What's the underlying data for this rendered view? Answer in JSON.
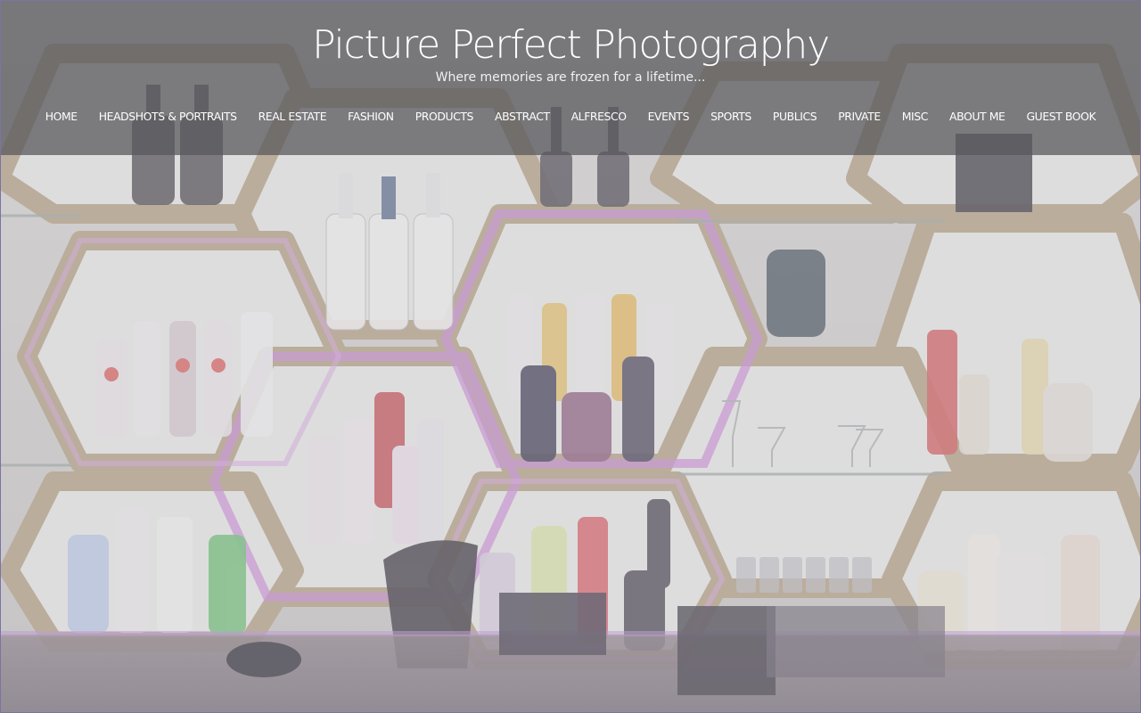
{
  "site": {
    "title": "Picture Perfect Photography",
    "tagline": "Where memories are frozen for a lifetime..."
  },
  "nav": {
    "items": [
      {
        "label": "HOME"
      },
      {
        "label": "HEADSHOTS & PORTRAITS"
      },
      {
        "label": "REAL ESTATE"
      },
      {
        "label": "FASHION"
      },
      {
        "label": "PRODUCTS"
      },
      {
        "label": "ABSTRACT"
      },
      {
        "label": "ALFRESCO"
      },
      {
        "label": "EVENTS"
      },
      {
        "label": "SPORTS"
      },
      {
        "label": "PUBLICS"
      },
      {
        "label": "PRIVATE"
      },
      {
        "label": "MISC"
      },
      {
        "label": "ABOUT ME"
      },
      {
        "label": "GUEST BOOK"
      }
    ]
  },
  "colors": {
    "header_overlay": "#58585c",
    "text": "#ffffff",
    "page_border": "#7b74a3",
    "shelf_wood": "#b9a58a",
    "purple_glow": "#c98ad6",
    "wall": "#e6e4e2"
  }
}
